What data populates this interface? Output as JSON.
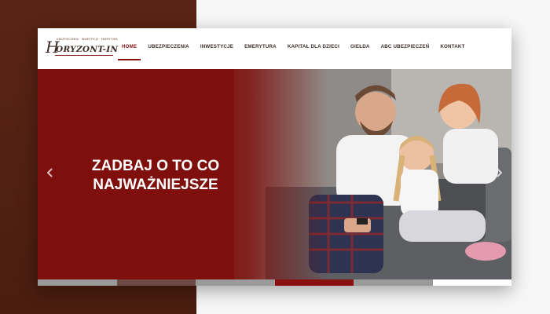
{
  "logo": {
    "tagline": "UBEZPIECZENIA · INWESTYCJE · EMERYTURA",
    "initial": "H",
    "word": "ORYZONT-IN"
  },
  "nav": {
    "items": [
      {
        "label": "HOME",
        "active": true
      },
      {
        "label": "UBEZPIECZENIA",
        "active": false
      },
      {
        "label": "INWESTYCJE",
        "active": false
      },
      {
        "label": "EMERYTURA",
        "active": false
      },
      {
        "label": "KAPITAŁ DLA DZIECI",
        "active": false
      },
      {
        "label": "GIEŁDA",
        "active": false
      },
      {
        "label": "ABC UBEZPIECZEŃ",
        "active": false
      },
      {
        "label": "KONTAKT",
        "active": false
      }
    ]
  },
  "hero": {
    "title_line1": "ZADBAJ O TO CO",
    "title_line2": "NAJWAŻNIEJSZE",
    "prev_icon": "chevron-left-icon",
    "next_icon": "chevron-right-icon",
    "photo_subject": "family-on-sofa-photo"
  },
  "slider": {
    "slide_count": 6,
    "current_slide": 4,
    "segment_colors": [
      "#9a9a9a",
      "#6d4a44",
      "#9a9a9a",
      "#8b1010",
      "#9a9a9a",
      "#ffffff"
    ]
  },
  "colors": {
    "accent": "#8b1010",
    "hero_bg": "#7e0f0c",
    "left_bg": "#5a2415"
  }
}
